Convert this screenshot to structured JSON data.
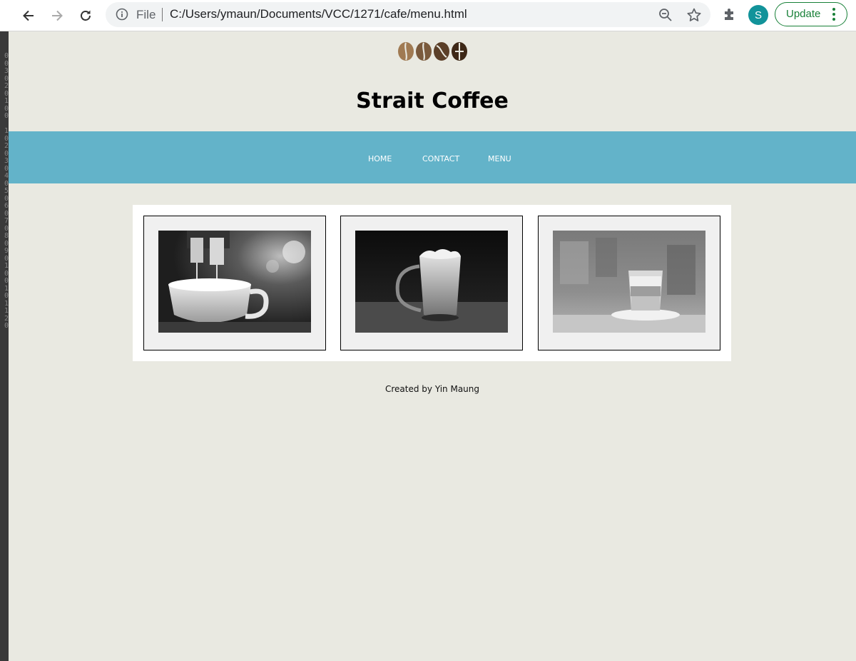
{
  "browser": {
    "omnibox_scheme": "File",
    "omnibox_url": "C:/Users/ymaun/Documents/VCC/1271/cafe/menu.html",
    "profile_initial": "S",
    "update_label": "Update",
    "accent_color": "#188038",
    "profile_color": "#12939a"
  },
  "editor_gutter": "0\n0\n3\n0\n2\n0\n1\n0\n0\n\n1\n0\n2\n0\n3\n0\n4\n0\n5\n0\n6\n0\n7\n0\n8\n0\n9\n0\n1\n0\n0\n1\n0\n1\n1\n2\n0",
  "site": {
    "title": "Strait Coffee",
    "logo_icon": "coffee-beans-icon",
    "nav": [
      {
        "label": "HOME"
      },
      {
        "label": "CONTACT"
      },
      {
        "label": "MENU"
      }
    ],
    "nav_color": "#63b3c9",
    "background_color": "#e9e9e1",
    "gallery": [
      {
        "image": "espresso-machine-cup-photo"
      },
      {
        "image": "glass-latte-mug-photo"
      },
      {
        "image": "layered-coffee-glass-photo"
      }
    ],
    "footer": "Created by Yin Maung"
  }
}
